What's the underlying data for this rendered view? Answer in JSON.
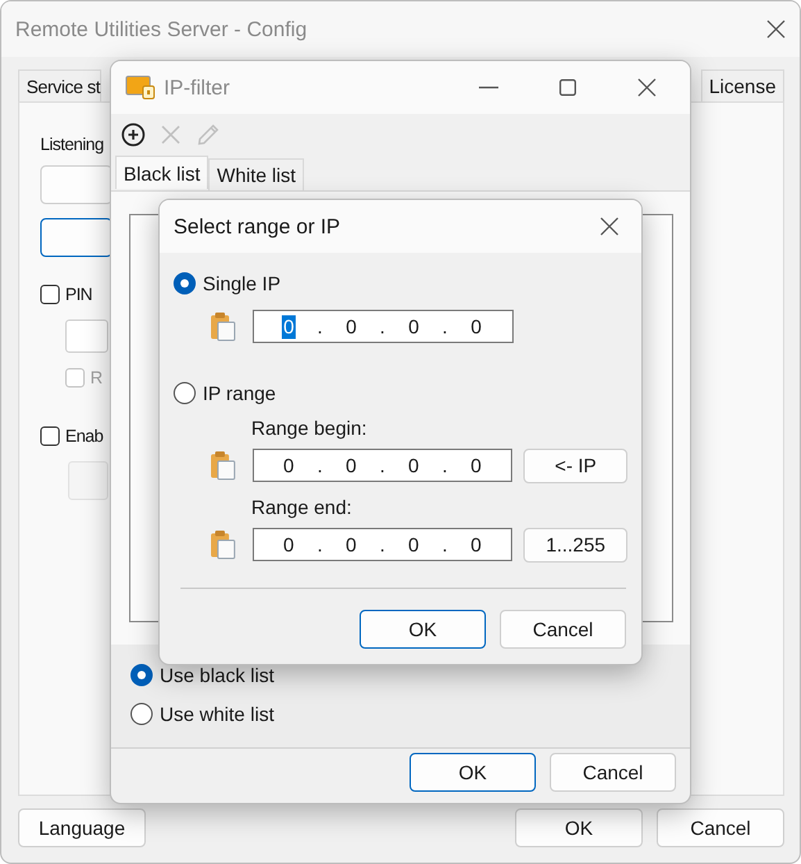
{
  "main_window": {
    "title": "Remote Utilities Server - Config",
    "tabs": [
      {
        "label": "Service st",
        "selected": false
      },
      {
        "label": "License",
        "selected": false
      }
    ],
    "listening_label": "Listening",
    "checkboxes": [
      {
        "label": "PIN",
        "checked": false,
        "disabled": false
      },
      {
        "label": "R",
        "checked": false,
        "disabled": true
      },
      {
        "label": "Enab",
        "checked": false,
        "disabled": false
      }
    ],
    "buttons": [
      "Language",
      "OK",
      "Cancel"
    ]
  },
  "ip_filter": {
    "title": "IP-filter",
    "toolbar": [
      {
        "kind": "add",
        "disabled": false
      },
      {
        "kind": "delete",
        "disabled": true
      },
      {
        "kind": "edit",
        "disabled": true
      }
    ],
    "tabs": [
      {
        "label": "Black list",
        "selected": true
      },
      {
        "label": "White list",
        "selected": false
      }
    ],
    "modes": [
      {
        "label": "Use black list",
        "selected": true
      },
      {
        "label": "Use white list",
        "selected": false
      }
    ],
    "buttons": [
      "OK",
      "Cancel"
    ]
  },
  "dialog": {
    "title": "Select range or IP",
    "options": [
      {
        "label": "Single IP",
        "selected": true
      },
      {
        "label": "IP range",
        "selected": false
      }
    ],
    "single_ip": {
      "separator": ".",
      "octets": [
        {
          "value": "0",
          "selected": true
        },
        {
          "value": "0",
          "selected": false
        },
        {
          "value": "0",
          "selected": false
        },
        {
          "value": "0",
          "selected": false
        }
      ]
    },
    "range_begin": {
      "label": "Range begin:",
      "separator": ".",
      "octets": [
        {
          "value": "0",
          "selected": false
        },
        {
          "value": "0",
          "selected": false
        },
        {
          "value": "0",
          "selected": false
        },
        {
          "value": "0",
          "selected": false
        }
      ],
      "button": "<- IP"
    },
    "range_end": {
      "label": "Range end:",
      "separator": ".",
      "octets": [
        {
          "value": "0",
          "selected": false
        },
        {
          "value": "0",
          "selected": false
        },
        {
          "value": "0",
          "selected": false
        },
        {
          "value": "0",
          "selected": false
        }
      ],
      "button": "1...255"
    },
    "buttons": [
      "OK",
      "Cancel"
    ]
  }
}
